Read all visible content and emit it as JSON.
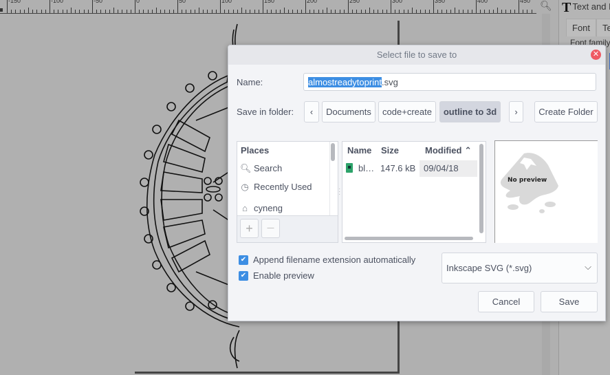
{
  "ruler": {
    "labels": [
      "-150",
      "-100",
      "-50",
      "0",
      "50",
      "100",
      "150",
      "200",
      "250",
      "300",
      "350",
      "400",
      "450"
    ]
  },
  "dock": {
    "title": "Text and Font",
    "tabs": [
      "Font",
      "Text"
    ],
    "font_family_label": "Font family"
  },
  "dialog": {
    "title": "Select file to save to",
    "name_label": "Name:",
    "name_selected": "almostreadytoprint",
    "name_rest": ".svg",
    "folder_label": "Save in folder:",
    "path": [
      "Documents",
      "code+create",
      "outline to 3d"
    ],
    "create_folder": "Create Folder",
    "places": {
      "header": "Places",
      "items": [
        {
          "icon": "search-icon",
          "label": "Search"
        },
        {
          "icon": "clock-icon",
          "label": "Recently Used"
        },
        {
          "icon": "home-icon",
          "label": "cyneng"
        }
      ]
    },
    "files": {
      "columns": [
        "Name",
        "Size",
        "Modified"
      ],
      "rows": [
        {
          "name": "bl…",
          "size": "147.6 kB",
          "modified": "09/04/18"
        }
      ]
    },
    "preview_text": "No preview",
    "append_ext": {
      "label": "Append filename extension automatically",
      "checked": true
    },
    "enable_preview": {
      "label": "Enable preview",
      "checked": true
    },
    "file_type": "Inkscape SVG (*.svg)",
    "cancel": "Cancel",
    "save": "Save"
  }
}
